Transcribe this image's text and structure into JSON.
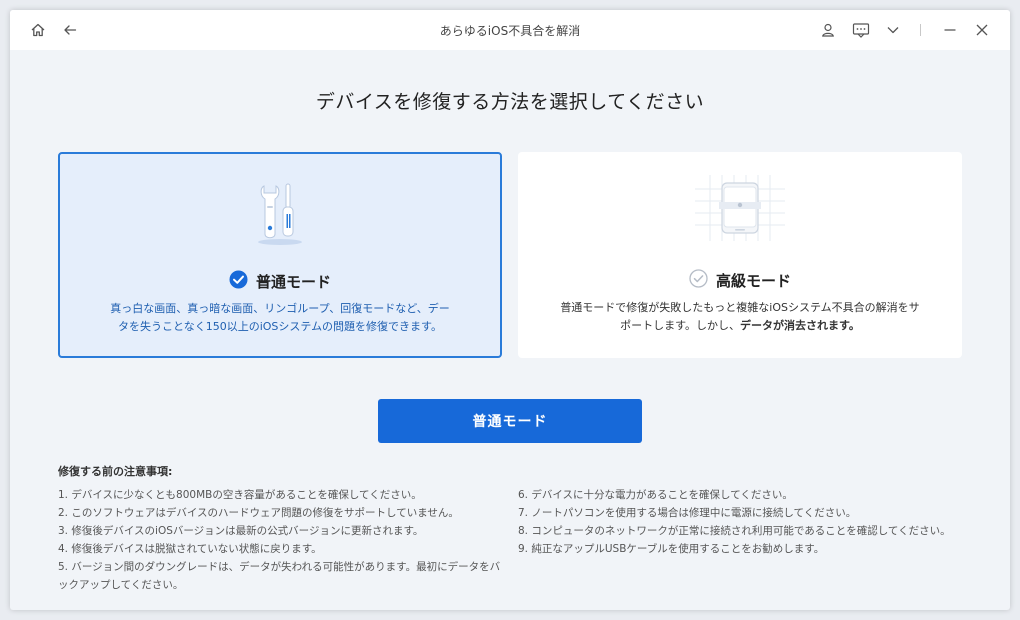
{
  "window": {
    "title": "あらゆるiOS不具合を解消"
  },
  "icons": {
    "home": "home-icon",
    "back": "back-arrow-icon",
    "user": "user-icon",
    "feedback": "chat-icon",
    "menu": "chevron-down-icon",
    "minimize": "minimize-icon",
    "close": "close-icon"
  },
  "page": {
    "heading": "デバイスを修復する方法を選択してください"
  },
  "modes": {
    "standard": {
      "title": "普通モード",
      "description": "真っ白な画面、真っ暗な画面、リンゴループ、回復モードなど、データを失うことなく150以上のiOSシステムの問題を修復できます。",
      "selected": true
    },
    "advanced": {
      "title": "高級モード",
      "description_prefix": "普通モードで修復が失敗したもっと複雑なiOSシステム不具合の解消をサポートします。しかし、",
      "description_emph": "データが消去されます。",
      "selected": false
    }
  },
  "action": {
    "button_label": "普通モード"
  },
  "notes": {
    "title": "修復する前の注意事項:",
    "left": [
      "1.  デバイスに少なくとも800MBの空き容量があることを確保してください。",
      "2.  このソフトウェアはデバイスのハードウェア問題の修復をサポートしていません。",
      "3.  修復後デバイスのiOSバージョンは最新の公式バージョンに更新されます。",
      "4.  修復後デバイスは脱獄されていない状態に戻ります。",
      "5.  バージョン間のダウングレードは、データが失われる可能性があります。最初にデータをバックアップしてください。"
    ],
    "right": [
      "6.  デバイスに十分な電力があることを確保してください。",
      "7.  ノートパソコンを使用する場合は修理中に電源に接続してください。",
      "8.  コンピュータのネットワークが正常に接続され利用可能であることを確認してください。",
      "9.  純正なアップルUSBケーブルを使用することをお勧めします。"
    ]
  },
  "colors": {
    "accent": "#1769d9",
    "selected_border": "#2a7bd9",
    "selected_bg": "#e5eefb"
  }
}
